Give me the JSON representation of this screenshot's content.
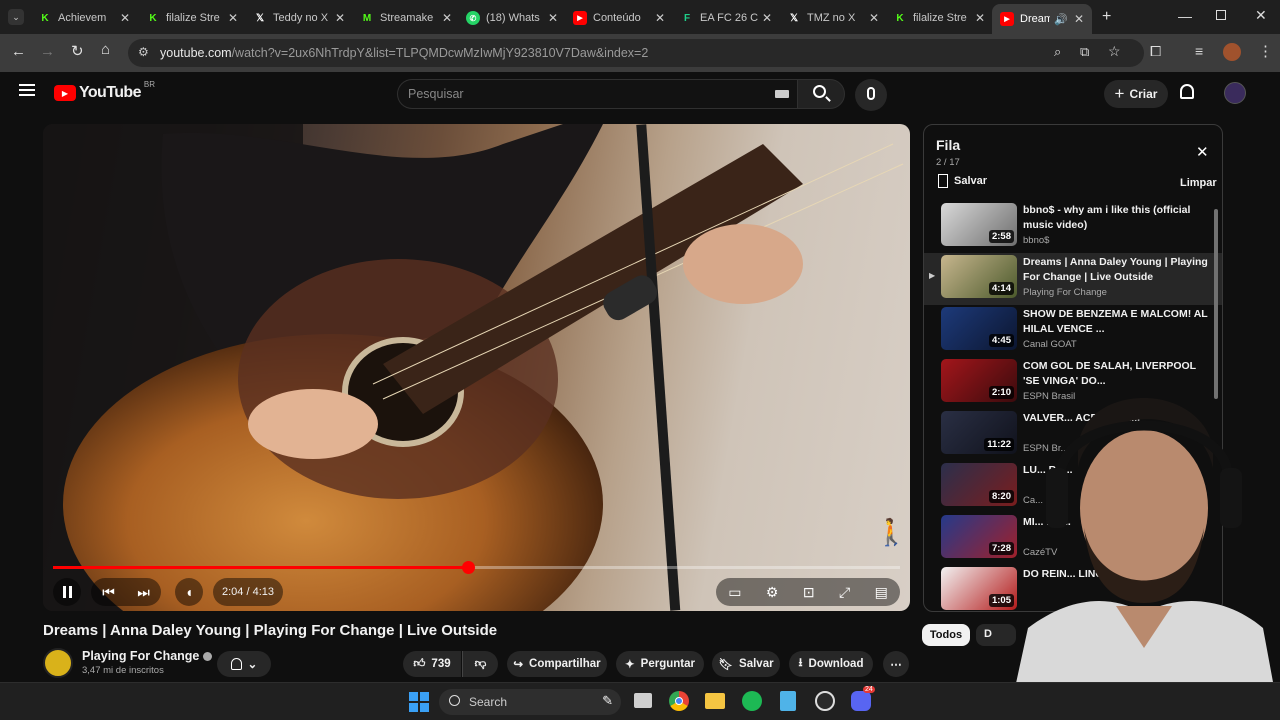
{
  "browser": {
    "tabs": [
      {
        "title": "Achievem",
        "icon": "kick-icon",
        "color": "#53fc18"
      },
      {
        "title": "filalize Stre",
        "icon": "kick-icon",
        "color": "#53fc18"
      },
      {
        "title": "Teddy no X",
        "icon": "x-icon",
        "color": "#ffffff"
      },
      {
        "title": "Streamake",
        "icon": "streamake-icon",
        "color": "#53fc18"
      },
      {
        "title": "(18) Whats",
        "icon": "whatsapp-icon",
        "color": "#25d366"
      },
      {
        "title": "Conteúdo",
        "icon": "youtube-icon",
        "color": "#ff0000"
      },
      {
        "title": "EA FC 26 C",
        "icon": "futbin-icon",
        "color": "#1fd08a"
      },
      {
        "title": "TMZ no X",
        "icon": "x-icon",
        "color": "#ffffff"
      },
      {
        "title": "filalize Stre",
        "icon": "kick-icon",
        "color": "#53fc18"
      },
      {
        "title": "Dream",
        "icon": "youtube-icon",
        "color": "#ff0000"
      }
    ],
    "url_host": "youtube.com",
    "url_path": "/watch?v=2ux6NhTrdpY&list=TLPQMDcwMzIwMjY923810V7Daw&index=2"
  },
  "youtube": {
    "logo_text": "YouTube",
    "region": "BR",
    "search_placeholder": "Pesquisar",
    "create_label": "Criar"
  },
  "player": {
    "time_current": "2:04",
    "time_total": "4:13",
    "progress": 0.49,
    "time_display": "2:04 / 4:13"
  },
  "video": {
    "title": "Dreams | Anna Daley Young | Playing For Change | Live Outside",
    "channel": "Playing For Change",
    "subscribers": "3,47 mi de inscritos",
    "likes": "739",
    "share_label": "Compartilhar",
    "ask_label": "Perguntar",
    "save_label": "Salvar",
    "download_label": "Download"
  },
  "queue": {
    "title": "Fila",
    "position": "2 / 17",
    "save_label": "Salvar",
    "clear_label": "Limpar",
    "items": [
      {
        "title": "bbno$ - why am i like this (official music video)",
        "channel": "bbno$",
        "duration": "2:58"
      },
      {
        "title": "Dreams | Anna Daley Young | Playing For Change | Live Outside",
        "channel": "Playing For Change",
        "duration": "4:14"
      },
      {
        "title": "SHOW DE BENZEMA E MALCOM! AL HILAL VENCE ...",
        "channel": "Canal GOAT",
        "duration": "4:45"
      },
      {
        "title": "COM GOL DE SALAH, LIVERPOOL 'SE VINGA' DO...",
        "channel": "ESPN Brasil",
        "duration": "2:10"
      },
      {
        "title": "VALVER... ACRÉSCIM...",
        "channel": "ESPN Br...",
        "duration": "11:22"
      },
      {
        "title": "LU... BA...",
        "channel": "Ca...",
        "duration": "8:20"
      },
      {
        "title": "MI... 1 X...",
        "channel": "CazéTV",
        "duration": "7:28"
      },
      {
        "title": "DO REIN... LINC...",
        "channel": "",
        "duration": "1:05"
      }
    ]
  },
  "chips": {
    "all": "Todos",
    "next": "D"
  },
  "taskbar": {
    "search_label": "Search",
    "discord_badge": "24"
  }
}
